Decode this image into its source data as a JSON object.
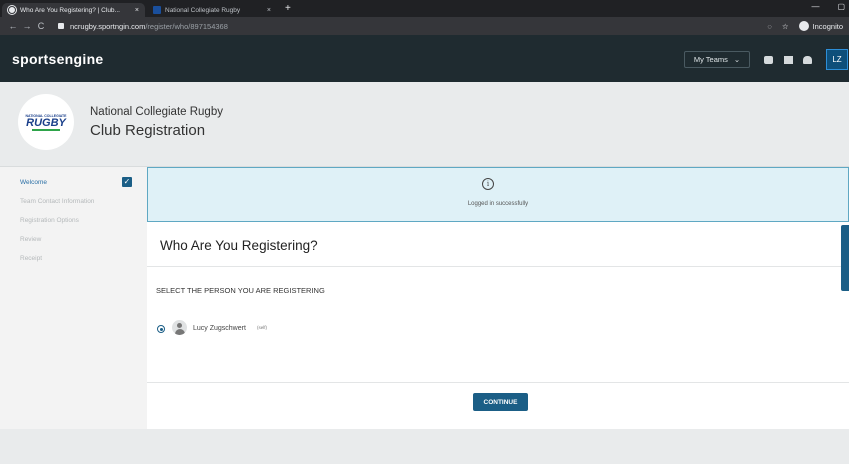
{
  "browser": {
    "tabs": [
      {
        "title": "Who Are You Registering? | Club...",
        "close": "×"
      },
      {
        "title": "National Collegiate Rugby",
        "close": "×"
      }
    ],
    "new_tab": "+",
    "nav": {
      "back": "←",
      "forward": "→",
      "reload": "C"
    },
    "url_host": "ncrugby.sportngin.com",
    "url_path": "/register/who/897154368",
    "incognito_label": "Incognito",
    "window": {
      "minimize": "—",
      "maximize": "▢"
    }
  },
  "topbar": {
    "logo": "sportsengine",
    "my_teams": "My Teams",
    "avatar_initials": "LZ"
  },
  "org": {
    "logo_small": "NATIONAL COLLEGIATE",
    "logo_big": "RUGBY",
    "name": "National Collegiate Rugby",
    "subtitle": "Club Registration"
  },
  "sidebar": {
    "steps": [
      {
        "label": "Welcome"
      },
      {
        "label": "Team Contact Information"
      },
      {
        "label": "Registration Options"
      },
      {
        "label": "Review"
      },
      {
        "label": "Receipt"
      }
    ],
    "check": "✓"
  },
  "alert": {
    "icon": "i",
    "message": "Logged in successfully"
  },
  "main": {
    "title": "Who Are You Registering?",
    "select_heading": "SELECT THE PERSON YOU ARE REGISTERING",
    "person_name": "Lucy Zugschwert",
    "person_tag": "(self)",
    "continue": "CONTINUE"
  }
}
